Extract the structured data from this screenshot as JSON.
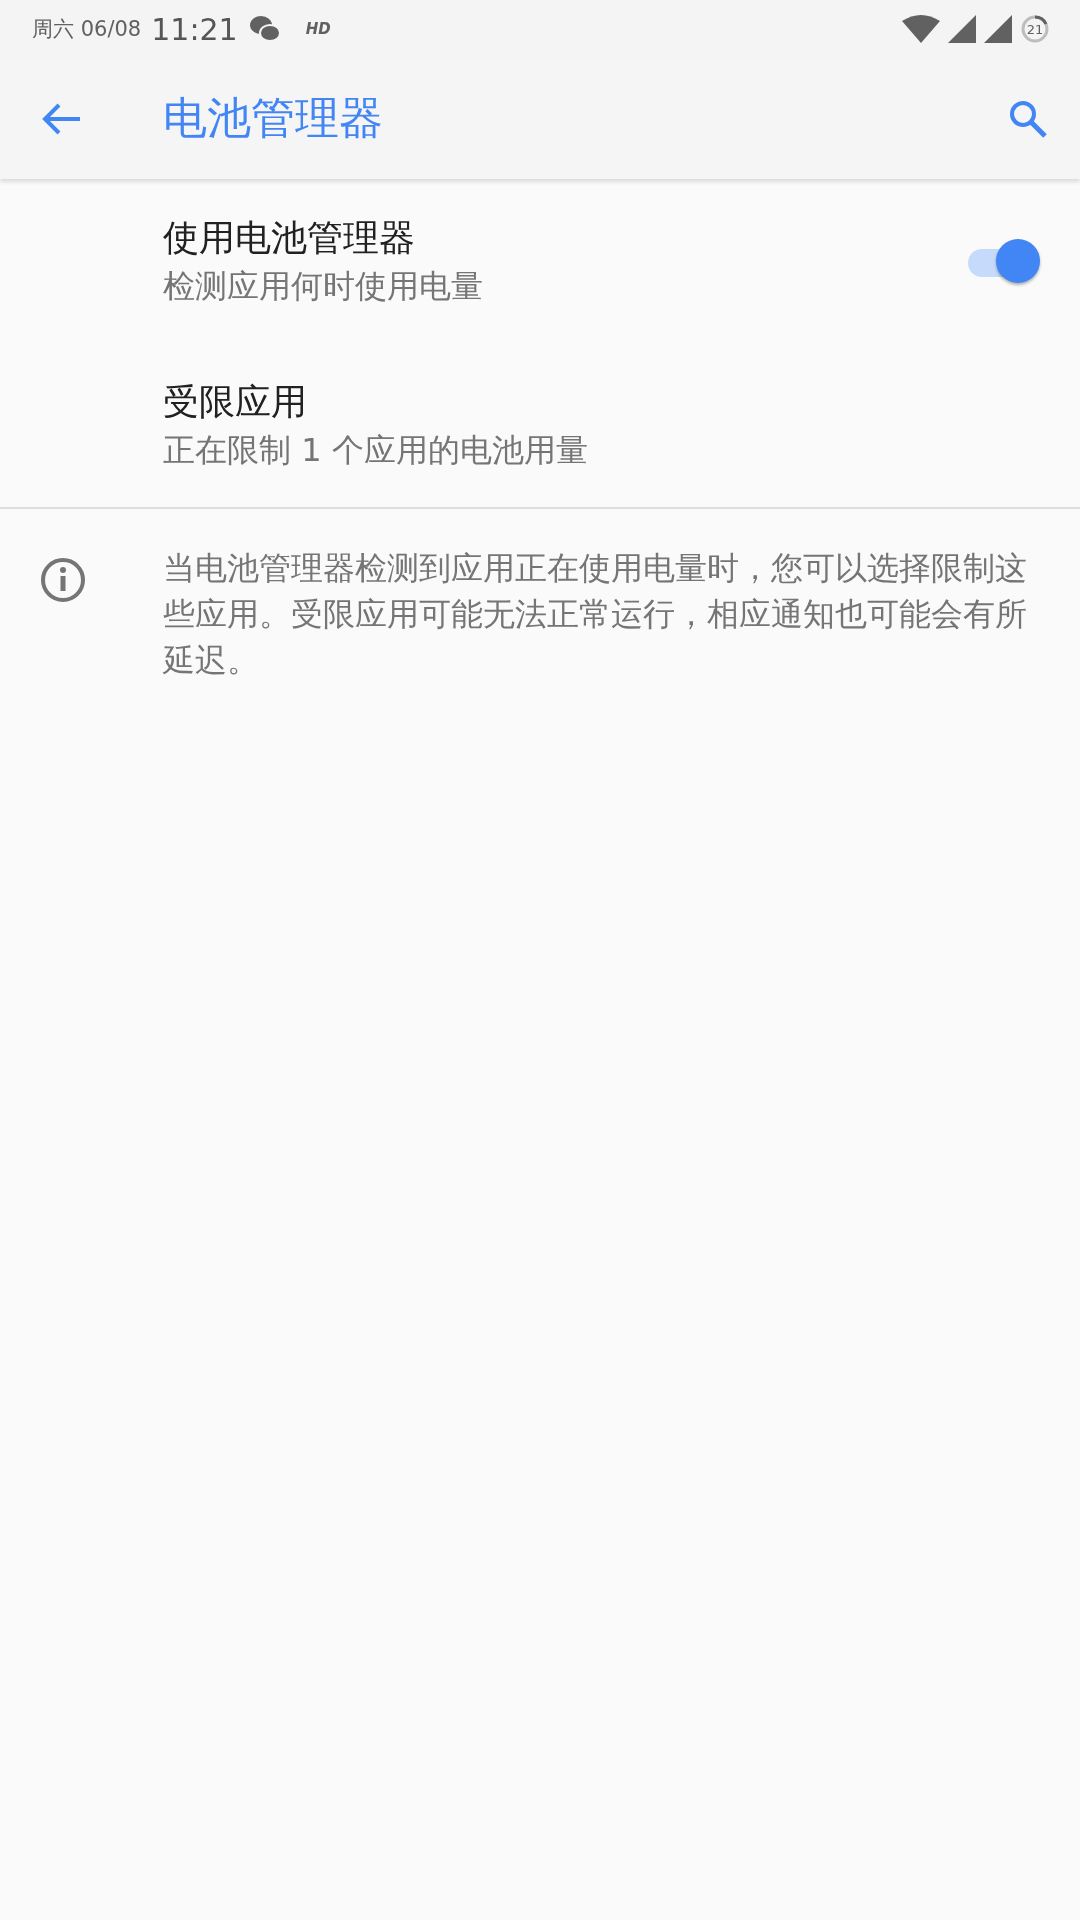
{
  "status_bar": {
    "date": "周六 06/08",
    "time": "11:21",
    "hd_label": "HD",
    "battery_percent": "21"
  },
  "app_bar": {
    "title": "电池管理器"
  },
  "preferences": [
    {
      "kind": "switch",
      "title": "使用电池管理器",
      "summary": "检测应用何时使用电量",
      "on": true
    },
    {
      "kind": "link",
      "title": "受限应用",
      "summary": "正在限制 1 个应用的电池用量"
    }
  ],
  "footer": {
    "text": "当电池管理器检测到应用正在使用电量时，您可以选择限制这些应用。受限应用可能无法正常运行，相应通知也可能会有所延迟。"
  }
}
